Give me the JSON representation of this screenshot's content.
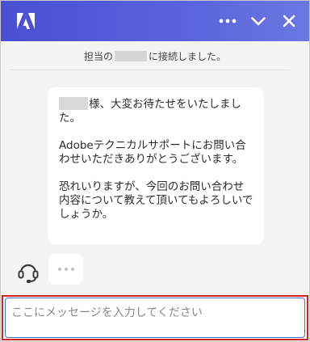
{
  "header": {
    "logo_icon": "adobe-logo-icon",
    "gradient_start": "#4a4fd3",
    "gradient_end": "#6a78e2",
    "actions": [
      "more-icon",
      "chevron-down-icon",
      "close-icon"
    ]
  },
  "system": {
    "connected_prefix": "担当の",
    "connected_suffix": "に接続しました。"
  },
  "message": {
    "line1_suffix": "様、大変お待たせをいたしました。",
    "line2": "Adobeテクニカルサポートにお問い合わせいただきありがとうございます。",
    "line3": "恐れいりますが、今回のお問い合わせ内容について教えて頂いてもよろしいでしょうか。"
  },
  "agent": {
    "avatar_icon": "headset-icon",
    "typing_icon": "typing-indicator-icon"
  },
  "composer": {
    "placeholder": "ここにメッセージを入力してください",
    "value": "",
    "highlight_color": "#d32020"
  }
}
